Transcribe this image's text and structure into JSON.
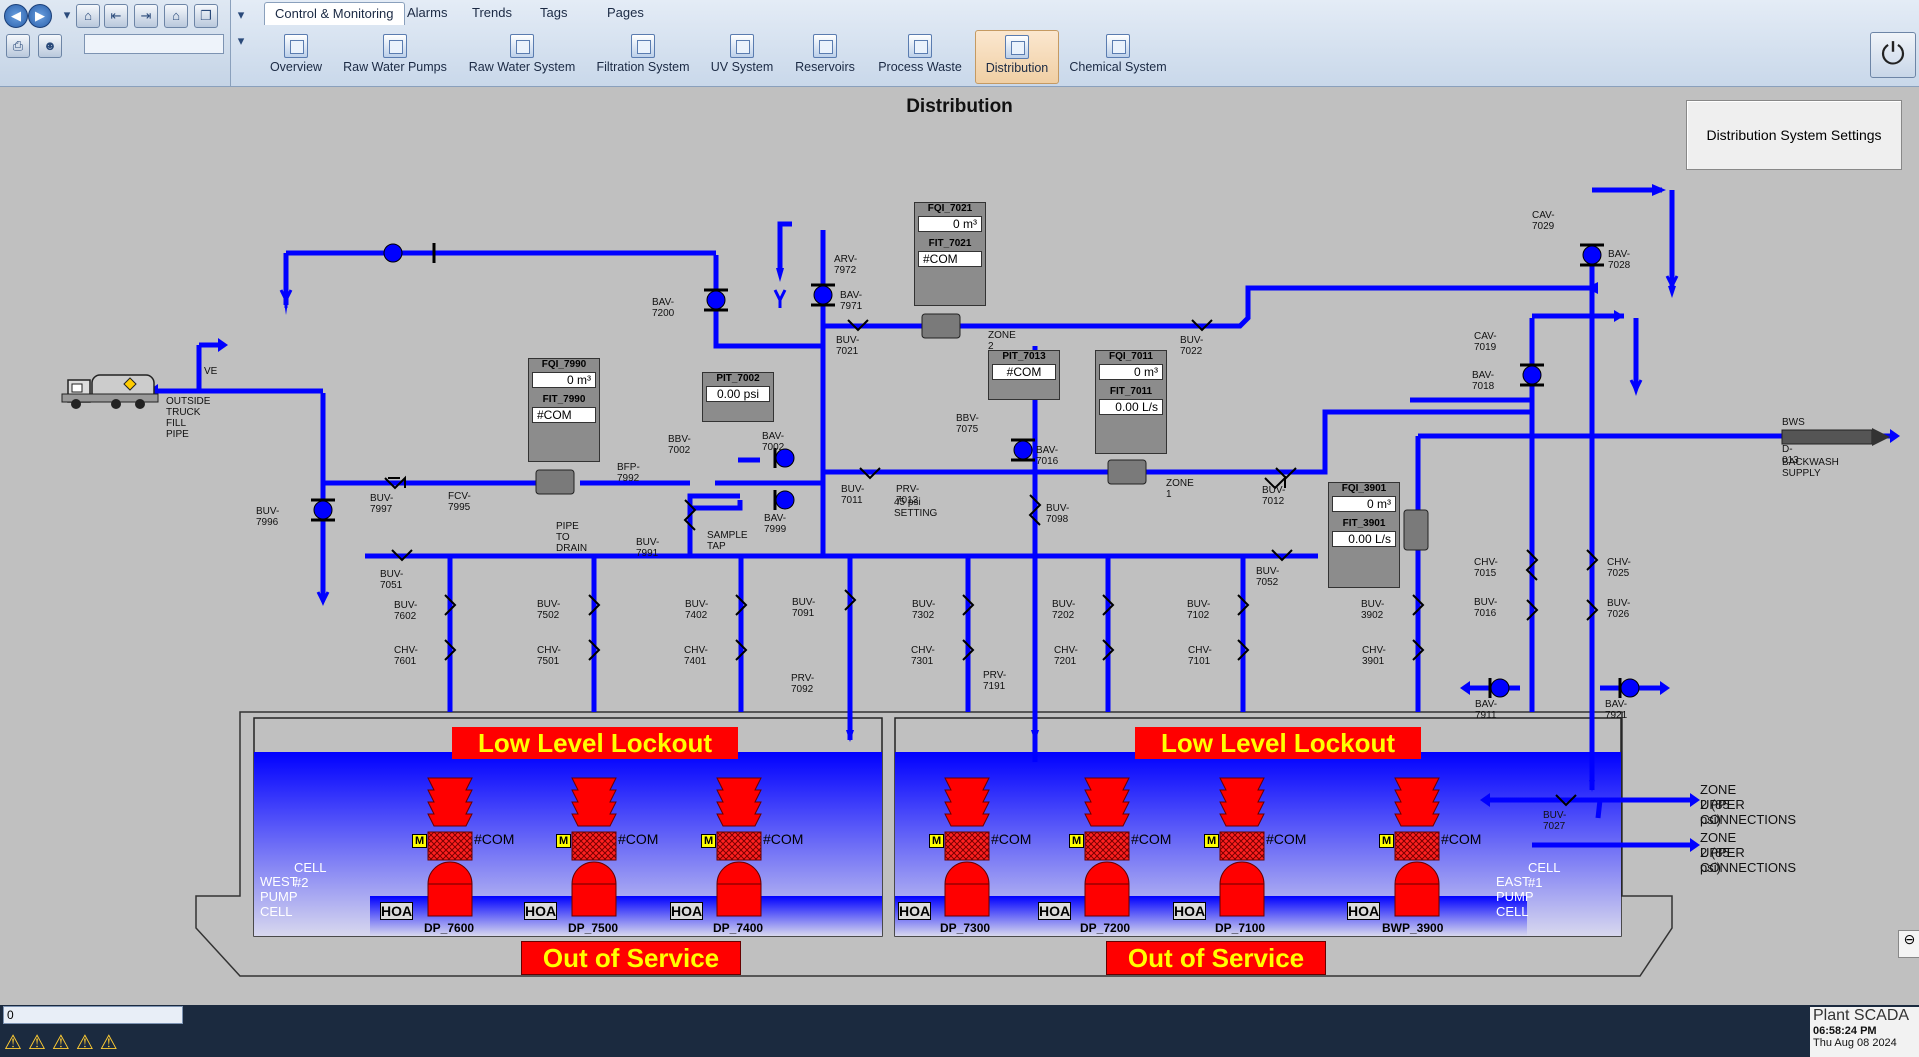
{
  "tabs": [
    "Control & Monitoring",
    "Alarms",
    "Trends",
    "Tags",
    "Pages"
  ],
  "ribbon": [
    "Overview",
    "Raw Water Pumps",
    "Raw Water System",
    "Filtration System",
    "UV System",
    "Reservoirs",
    "Process Waste",
    "Distribution",
    "Chemical System"
  ],
  "page_title": "Distribution",
  "settings_button": "Distribution System Settings",
  "meters": {
    "fqi_7021": {
      "label": "FQI_7021",
      "value": "0 m³"
    },
    "fit_7021": {
      "label": "FIT_7021",
      "value": "#COM"
    },
    "fqi_7990": {
      "label": "FQI_7990",
      "value": "0 m³"
    },
    "fit_7990": {
      "label": "FIT_7990",
      "value": "#COM"
    },
    "pit_7002": {
      "label": "PIT_7002",
      "value": "0.00 psi"
    },
    "pit_7013": {
      "label": "PIT_7013",
      "value": "#COM"
    },
    "fqi_7011": {
      "label": "FQI_7011",
      "value": "0 m³"
    },
    "fit_7011": {
      "label": "FIT_7011",
      "value": "0.00 L/s"
    },
    "fqi_3901": {
      "label": "FQI_3901",
      "value": "0 m³"
    },
    "fit_3901": {
      "label": "FIT_3901",
      "value": "0.00 L/s"
    }
  },
  "labels": {
    "arv_7972": "ARV-7972",
    "bav_7971": "BAV-7971",
    "bav_7200": "BAV-7200",
    "buv_7021": "BUV-7021",
    "zone2": "ZONE 2",
    "buv_7022": "BUV-7022",
    "cav_7029": "CAV-7029",
    "bav_7028": "BAV-7028",
    "cav_7019": "CAV-7019",
    "bav_7018": "BAV-7018",
    "ve": "VE",
    "truck_pipe": "OUTSIDE TRUCK FILL PIPE",
    "bbv_7002": "BBV-7002",
    "bav_7002": "BAV-7002",
    "bbv_7075": "BBV-7075",
    "bav_7016": "BAV-7016",
    "bws": "BWS",
    "d013": "D-013",
    "backwash": "BACKWASH SUPPLY",
    "buv_7997": "BUV-7997",
    "fcv_7995": "FCV-7995",
    "bfp_7992": "BFP-7992",
    "bav_7999": "BAV-7999",
    "buv_7011": "BUV-7011",
    "prv_7013": "PRV-7013",
    "psi_setting": "45 psi SETTING",
    "buv_7098": "BUV-7098",
    "zone1": "ZONE 1",
    "buv_7012": "BUV-7012",
    "buv_7996": "BUV-7996",
    "pipe_drain": "PIPE TO DRAIN",
    "buv_7991": "BUV-7991",
    "sample_tap": "SAMPLE TAP",
    "buv_7051": "BUV-7051",
    "buv_7052": "BUV-7052",
    "chv_7015": "CHV-7015",
    "chv_7025": "CHV-7025",
    "buv_7016": "BUV-7016",
    "buv_7026": "BUV-7026",
    "buv_7602": "BUV-7602",
    "buv_7502": "BUV-7502",
    "buv_7402": "BUV-7402",
    "buv_7091": "BUV-7091",
    "buv_7302": "BUV-7302",
    "buv_7202": "BUV-7202",
    "buv_7102": "BUV-7102",
    "buv_3902": "BUV-3902",
    "chv_7601": "CHV-7601",
    "chv_7501": "CHV-7501",
    "chv_7401": "CHV-7401",
    "chv_7301": "CHV-7301",
    "chv_7201": "CHV-7201",
    "chv_7101": "CHV-7101",
    "chv_3901": "CHV-3901",
    "prv_7092": "PRV-7092",
    "prv_7191": "PRV-7191",
    "bav_7911": "BAV-7911",
    "bav_7921": "BAV-7921",
    "buv_7027": "BUV-7027",
    "zone2_upper1a": "ZONE 2 (85 psi)",
    "zone2_upper1b": "UPPER CONNECTIONS",
    "zone2_upper2a": "ZONE 2 (85 psi)",
    "zone2_upper2b": "UPPER CONNECTIONS",
    "cell2a": "CELL #2",
    "cell2b": "WEST PUMP CELL",
    "cell1a": "CELL #1",
    "cell1b": "EAST PUMP CELL"
  },
  "banners": {
    "lockout_west": "Low Level Lockout",
    "lockout_east": "Low Level Lockout",
    "oos_west": "Out of Service",
    "oos_east": "Out of Service"
  },
  "pumps": [
    {
      "name": "DP_7600",
      "status": "#COM",
      "mode": "M",
      "hoa": "HOA"
    },
    {
      "name": "DP_7500",
      "status": "#COM",
      "mode": "M",
      "hoa": "HOA"
    },
    {
      "name": "DP_7400",
      "status": "#COM",
      "mode": "M",
      "hoa": "HOA"
    },
    {
      "name": "DP_7300",
      "status": "#COM",
      "mode": "M",
      "hoa": "HOA"
    },
    {
      "name": "DP_7200",
      "status": "#COM",
      "mode": "M",
      "hoa": "HOA"
    },
    {
      "name": "DP_7100",
      "status": "#COM",
      "mode": "M",
      "hoa": "HOA"
    },
    {
      "name": "BWP_3900",
      "status": "#COM",
      "mode": "M",
      "hoa": "HOA"
    }
  ],
  "bottom": {
    "input": "0",
    "brand": "Plant SCADA",
    "time": "06:58:24 PM",
    "date": "Thu Aug 08 2024"
  },
  "colors": {
    "pipe": "#0000ff",
    "pump": "#ff0000",
    "banner_bg": "#ff0000",
    "banner_text": "#ffff00",
    "background": "#c0c0c0"
  }
}
